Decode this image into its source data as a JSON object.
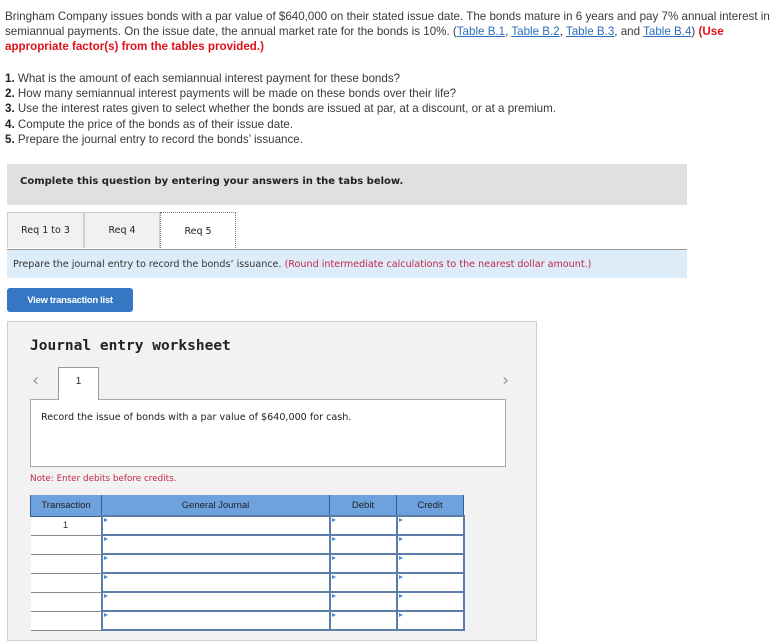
{
  "problem": {
    "text": "Bringham Company issues bonds with a par value of $640,000 on their stated issue date. The bonds mature in 6 years and pay 7% annual interest in semiannual payments. On the issue date, the annual market rate for the bonds is 10%. (",
    "links": [
      "Table B.1",
      "Table B.2",
      "Table B.3",
      "Table B.4"
    ],
    "sep1": ", ",
    "sep2": ", ",
    "sep3": ", and ",
    "close": ") ",
    "instruction": "(Use appropriate factor(s) from the tables provided.)"
  },
  "requirements": [
    {
      "num": "1.",
      "text": " What is the amount of each semiannual interest payment for these bonds?"
    },
    {
      "num": "2.",
      "text": " How many semiannual interest payments will be made on these bonds over their life?"
    },
    {
      "num": "3.",
      "text": " Use the interest rates given to select whether the bonds are issued at par, at a discount, or at a premium."
    },
    {
      "num": "4.",
      "text": " Compute the price of the bonds as of their issue date."
    },
    {
      "num": "5.",
      "text": " Prepare the journal entry to record the bonds’ issuance."
    }
  ],
  "banner": "Complete this question by entering your answers in the tabs below.",
  "tabs": [
    {
      "label": "Req 1 to 3",
      "active": false
    },
    {
      "label": "Req 4",
      "active": false
    },
    {
      "label": "Req 5",
      "active": true
    }
  ],
  "instructions": {
    "text": "Prepare the journal entry to record the bonds’ issuance. ",
    "note": "(Round intermediate calculations to the nearest dollar amount.)"
  },
  "view_transaction_list": "View transaction list",
  "worksheet": {
    "title": "Journal entry worksheet",
    "prev_icon": "‹",
    "next_icon": "›",
    "current_transaction": "1",
    "description": "Record the issue of bonds with a par value of $640,000 for cash.",
    "note": "Note: Enter debits before credits.",
    "columns": [
      "Transaction",
      "General Journal",
      "Debit",
      "Credit"
    ],
    "rows": [
      {
        "transaction": "1",
        "account": "",
        "debit": "",
        "credit": ""
      },
      {
        "transaction": "",
        "account": "",
        "debit": "",
        "credit": ""
      },
      {
        "transaction": "",
        "account": "",
        "debit": "",
        "credit": ""
      },
      {
        "transaction": "",
        "account": "",
        "debit": "",
        "credit": ""
      },
      {
        "transaction": "",
        "account": "",
        "debit": "",
        "credit": ""
      },
      {
        "transaction": "",
        "account": "",
        "debit": "",
        "credit": ""
      }
    ]
  },
  "colors": {
    "link": "#2a6ebb",
    "alert_red": "#e0111b",
    "note_red": "#c3274a",
    "button_blue": "#3677c4",
    "table_header": "#6da2df",
    "instruction_bg": "#dcecf8"
  }
}
